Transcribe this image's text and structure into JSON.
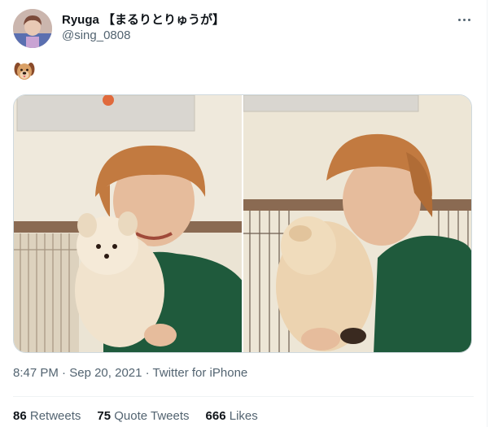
{
  "user": {
    "display_name": "Ryuga 【まるりとりゅうが】",
    "handle": "@sing_0808",
    "avatar_icon": "profile-avatar"
  },
  "tweet": {
    "emoji_icon": "dog-face-emoji",
    "media_count": 2
  },
  "meta": {
    "time": "8:47 PM",
    "separator": "·",
    "date": "Sep 20, 2021",
    "source": "Twitter for iPhone"
  },
  "stats": {
    "retweets_count": "86",
    "retweets_label": "Retweets",
    "quotes_count": "75",
    "quotes_label": "Quote Tweets",
    "likes_count": "666",
    "likes_label": "Likes"
  },
  "colors": {
    "text_primary": "#0f1419",
    "text_secondary": "#536471",
    "border": "#cfd9de",
    "divider": "#eff3f4"
  }
}
